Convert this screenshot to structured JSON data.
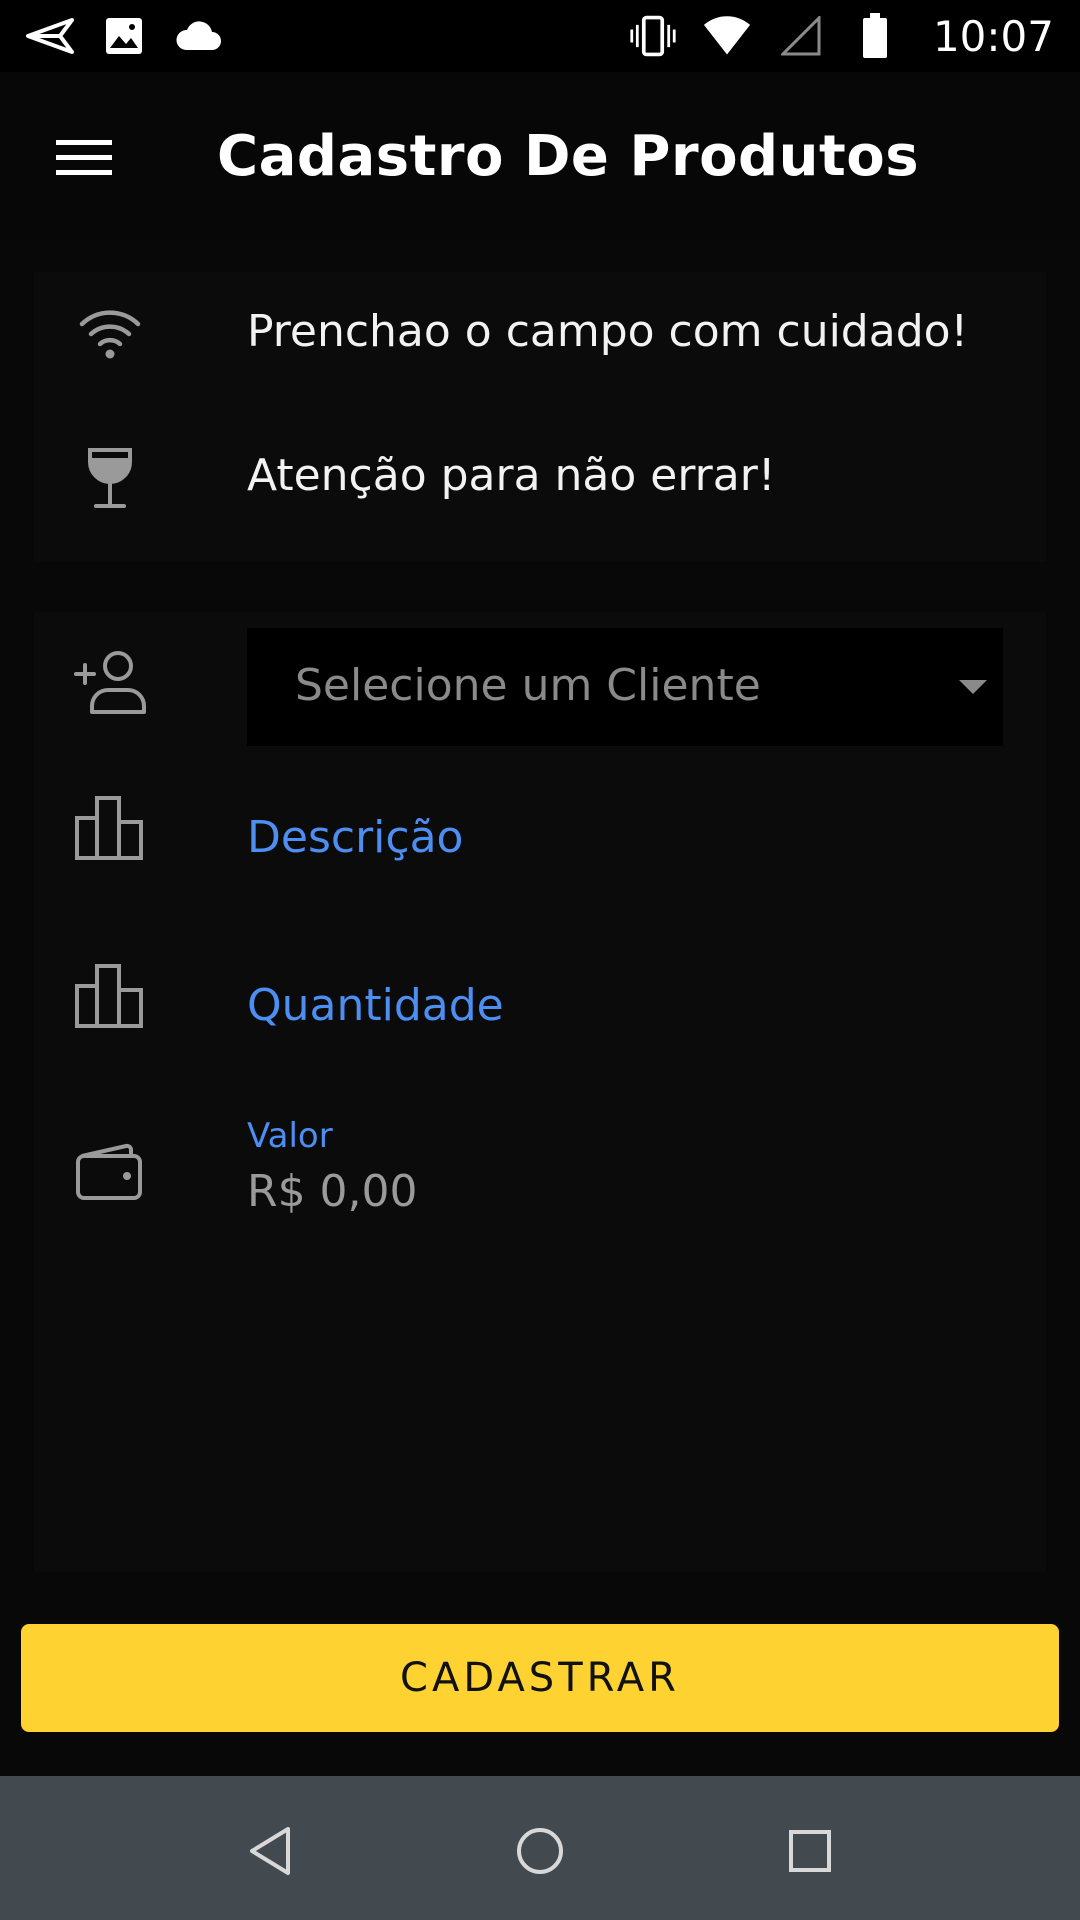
{
  "status_bar": {
    "time": "10:07",
    "icons_left": [
      "send-icon",
      "image-icon",
      "cloud-icon"
    ],
    "icons_right": [
      "vibrate-icon",
      "wifi-icon",
      "cell-signal-icon",
      "battery-icon"
    ]
  },
  "app_bar": {
    "menu_icon": "menu-icon",
    "title": "Cadastro De Produtos"
  },
  "info": {
    "rows": [
      {
        "icon": "wifi-icon",
        "text": "Prenchao o campo com cuidado!"
      },
      {
        "icon": "wine-glass-icon",
        "text": "Atenção para não errar!"
      }
    ]
  },
  "form": {
    "client_select": {
      "icon": "person-add-icon",
      "placeholder": "Selecione um Cliente"
    },
    "descricao": {
      "icon": "bar-chart-icon",
      "label": "Descrição"
    },
    "quantidade": {
      "icon": "bar-chart-icon",
      "label": "Quantidade"
    },
    "valor": {
      "icon": "wallet-icon",
      "label": "Valor",
      "value": "R$ 0,00"
    }
  },
  "actions": {
    "submit_label": "CADASTRAR"
  },
  "colors": {
    "accent_blue": "#4c8ef2",
    "button_yellow": "#fdd231",
    "background": "#080808",
    "nav_bar": "#434a4f"
  },
  "nav_bar": {
    "buttons": [
      "back-icon",
      "home-icon",
      "recents-icon"
    ]
  }
}
